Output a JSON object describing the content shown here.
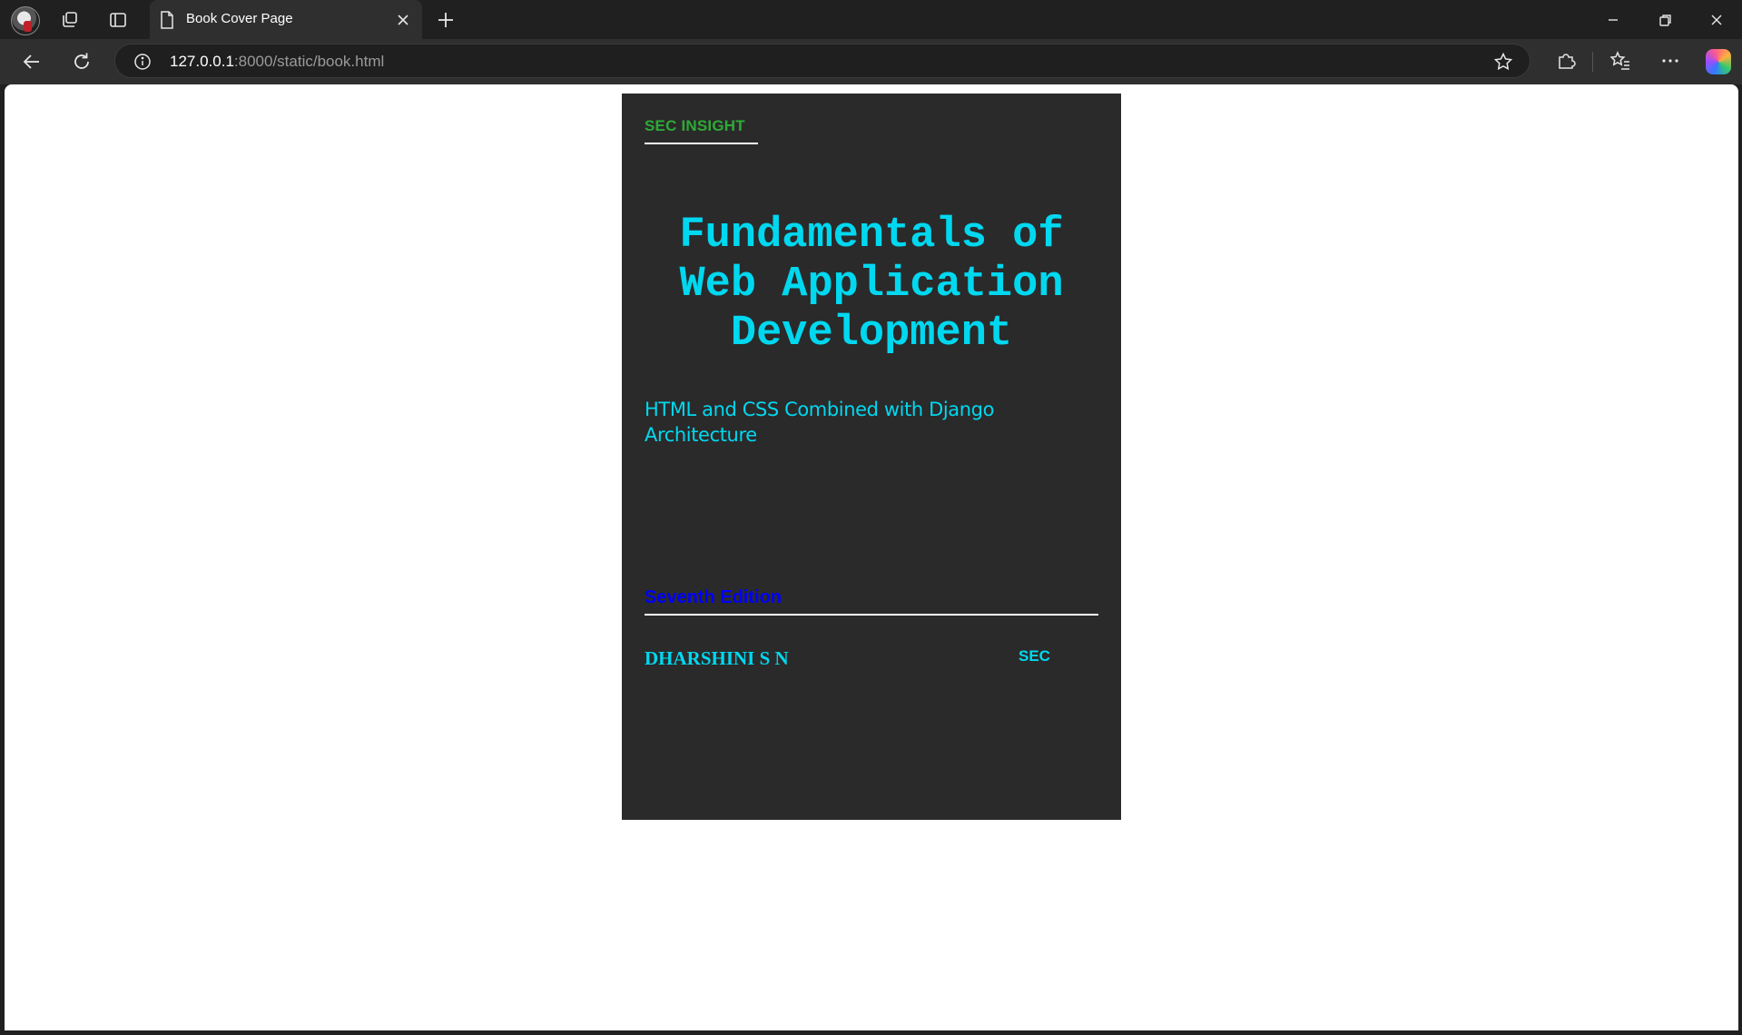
{
  "browser": {
    "tab_title": "Book Cover Page",
    "url_host": "127.0.0.1",
    "url_rest": ":8000/static/book.html"
  },
  "cover": {
    "brand": "SEC INSIGHT",
    "title_lines": [
      "Fundamentals of",
      "Web Application",
      "Development"
    ],
    "subtitle_lines": [
      "HTML and CSS Combined with Django",
      "Architecture"
    ],
    "edition": "Seventh Edition",
    "author": "DHARSHINI S N",
    "publisher": "SEC",
    "colors": {
      "background": "#2a2a2a",
      "brand": "#2eaa37",
      "title": "#00d8f0",
      "edition": "#0000ff"
    }
  }
}
